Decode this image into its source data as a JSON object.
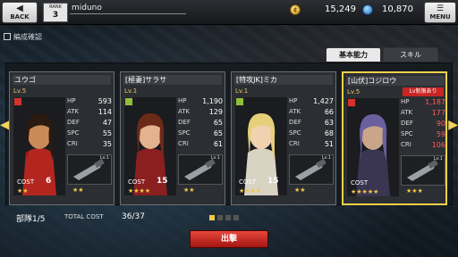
{
  "topbar": {
    "back_label": "BACK",
    "rank_label": "RANK",
    "rank_value": "3",
    "player_name": "miduno",
    "coins": "15,249",
    "gems": "10,870",
    "menu_label": "MENU"
  },
  "section": {
    "title": "編成確認"
  },
  "tabs": [
    {
      "label": "基本能力",
      "active": true
    },
    {
      "label": "スキル",
      "active": false
    }
  ],
  "cards": [
    {
      "name": "ユウゴ",
      "level": "Lv.5",
      "badge": "",
      "hp": "593",
      "atk": "114",
      "def": "47",
      "spc": "55",
      "cri": "35",
      "cost": "6",
      "char_stars": "★★",
      "weapon_level": "Lv.1",
      "weapon_stars": "★★",
      "type_color": "#d6322b",
      "hair": "#2a1a10",
      "skin": "#c98a5a",
      "outfit": "#b3261f"
    },
    {
      "name": "[極妻]サラサ",
      "level": "Lv.1",
      "badge": "",
      "hp": "1,190",
      "atk": "129",
      "def": "65",
      "spc": "65",
      "cri": "61",
      "cost": "15",
      "char_stars": "★★★★",
      "weapon_level": "Lv.1",
      "weapon_stars": "★★",
      "type_color": "#8fbf3a",
      "hair": "#6b2a18",
      "skin": "#e2b38e",
      "outfit": "#8a1f1f"
    },
    {
      "name": "[特攻JK]ミカ",
      "level": "Lv.1",
      "badge": "",
      "hp": "1,427",
      "atk": "66",
      "def": "63",
      "spc": "68",
      "cri": "51",
      "cost": "15",
      "char_stars": "★★★★",
      "weapon_level": "Lv.1",
      "weapon_stars": "★★",
      "type_color": "#8fbf3a",
      "hair": "#e6cf7a",
      "skin": "#f0d2b0",
      "outfit": "#d9d3c4"
    },
    {
      "name": "[山伏]コジロウ",
      "level": "Lv.5",
      "badge": "Lv制限あり",
      "hp": "1,187",
      "atk": "177",
      "def": "90",
      "spc": "59",
      "cri": "106",
      "cost": "",
      "char_stars": "★★★★★",
      "weapon_level": "Lv.1",
      "weapon_stars": "★★★",
      "type_color": "#d6322b",
      "hair": "#6b5fa0",
      "skin": "#c9a58a",
      "outfit": "#3a3550"
    }
  ],
  "stat_labels": {
    "hp": "HP",
    "atk": "ATK",
    "def": "DEF",
    "spc": "SPC",
    "cri": "CRI",
    "cost": "COST"
  },
  "footer": {
    "squad": "部隊1/5",
    "total_cost_label": "TOTAL COST",
    "total_cost_value": "36/37",
    "page_current": 1,
    "page_total": 4,
    "sortie_label": "出撃"
  },
  "colors": {
    "accent_gold": "#f0d04a",
    "sortie_red": "#c92a22"
  }
}
